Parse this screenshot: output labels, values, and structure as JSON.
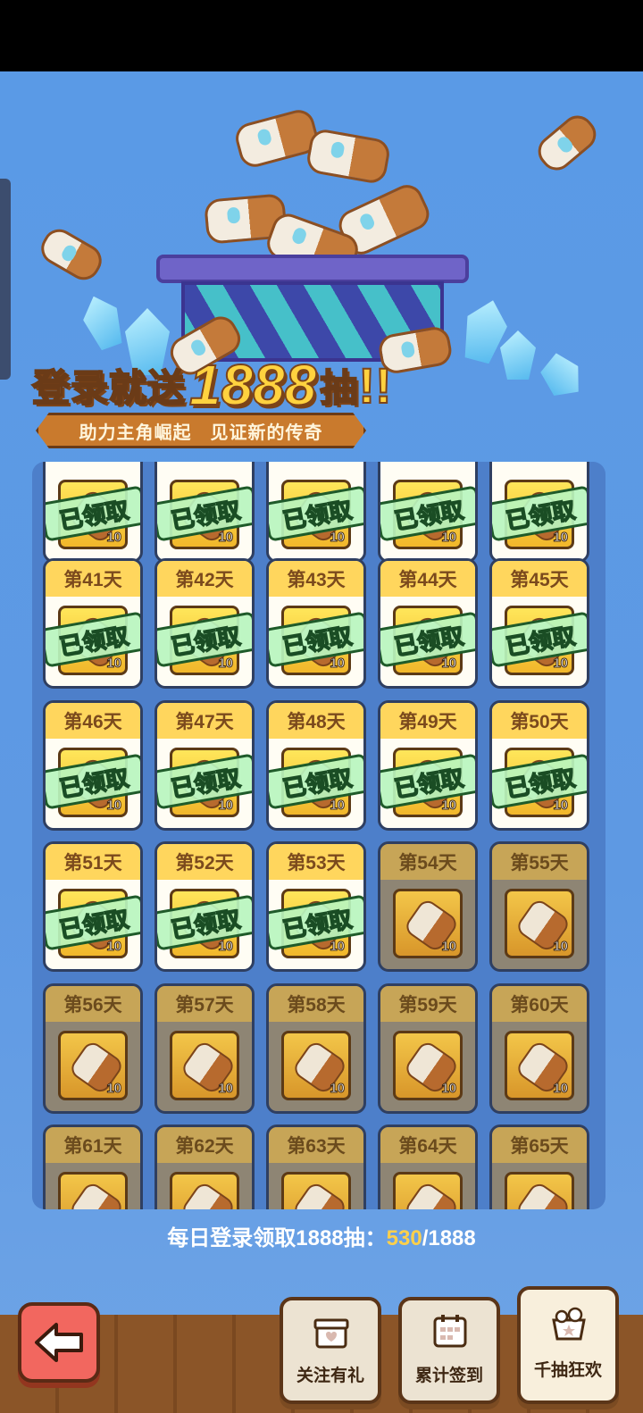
{
  "hero": {
    "title_prefix": "登录就送",
    "title_number": "1888",
    "title_suffix": "抽",
    "title_exclaim": "!!",
    "subtitle": "助力主角崛起　见证新的传奇"
  },
  "claimed_stamp": "已领取",
  "reward_quantity": "10",
  "grid": {
    "top_row": [
      {
        "day_label": "",
        "status": "claimed"
      },
      {
        "day_label": "",
        "status": "claimed"
      },
      {
        "day_label": "",
        "status": "claimed"
      },
      {
        "day_label": "",
        "status": "claimed"
      },
      {
        "day_label": "",
        "status": "claimed"
      }
    ],
    "days": [
      {
        "day_label": "第41天",
        "status": "claimed"
      },
      {
        "day_label": "第42天",
        "status": "claimed"
      },
      {
        "day_label": "第43天",
        "status": "claimed"
      },
      {
        "day_label": "第44天",
        "status": "claimed"
      },
      {
        "day_label": "第45天",
        "status": "claimed"
      },
      {
        "day_label": "第46天",
        "status": "claimed"
      },
      {
        "day_label": "第47天",
        "status": "claimed"
      },
      {
        "day_label": "第48天",
        "status": "claimed"
      },
      {
        "day_label": "第49天",
        "status": "claimed"
      },
      {
        "day_label": "第50天",
        "status": "claimed"
      },
      {
        "day_label": "第51天",
        "status": "claimed"
      },
      {
        "day_label": "第52天",
        "status": "claimed"
      },
      {
        "day_label": "第53天",
        "status": "claimed"
      },
      {
        "day_label": "第54天",
        "status": "locked"
      },
      {
        "day_label": "第55天",
        "status": "locked"
      },
      {
        "day_label": "第56天",
        "status": "locked"
      },
      {
        "day_label": "第57天",
        "status": "locked"
      },
      {
        "day_label": "第58天",
        "status": "locked"
      },
      {
        "day_label": "第59天",
        "status": "locked"
      },
      {
        "day_label": "第60天",
        "status": "locked"
      },
      {
        "day_label": "第61天",
        "status": "locked"
      },
      {
        "day_label": "第62天",
        "status": "locked"
      },
      {
        "day_label": "第63天",
        "status": "locked"
      },
      {
        "day_label": "第64天",
        "status": "locked"
      },
      {
        "day_label": "第65天",
        "status": "locked"
      }
    ]
  },
  "progress": {
    "label": "每日登录领取1888抽：",
    "current": "530",
    "total": "/1888"
  },
  "nav": {
    "back_icon": "arrow-left-icon",
    "follow_label": "关注有礼",
    "checkin_label": "累计签到",
    "draws_label": "千抽狂欢"
  },
  "colors": {
    "background": "#5b98e3",
    "card_header_claimed": "#ffd65d",
    "card_header_locked": "#c7a557",
    "stamp_green": "#b9f5be",
    "progress_highlight": "#ffd04a",
    "back_button": "#f2675f"
  }
}
